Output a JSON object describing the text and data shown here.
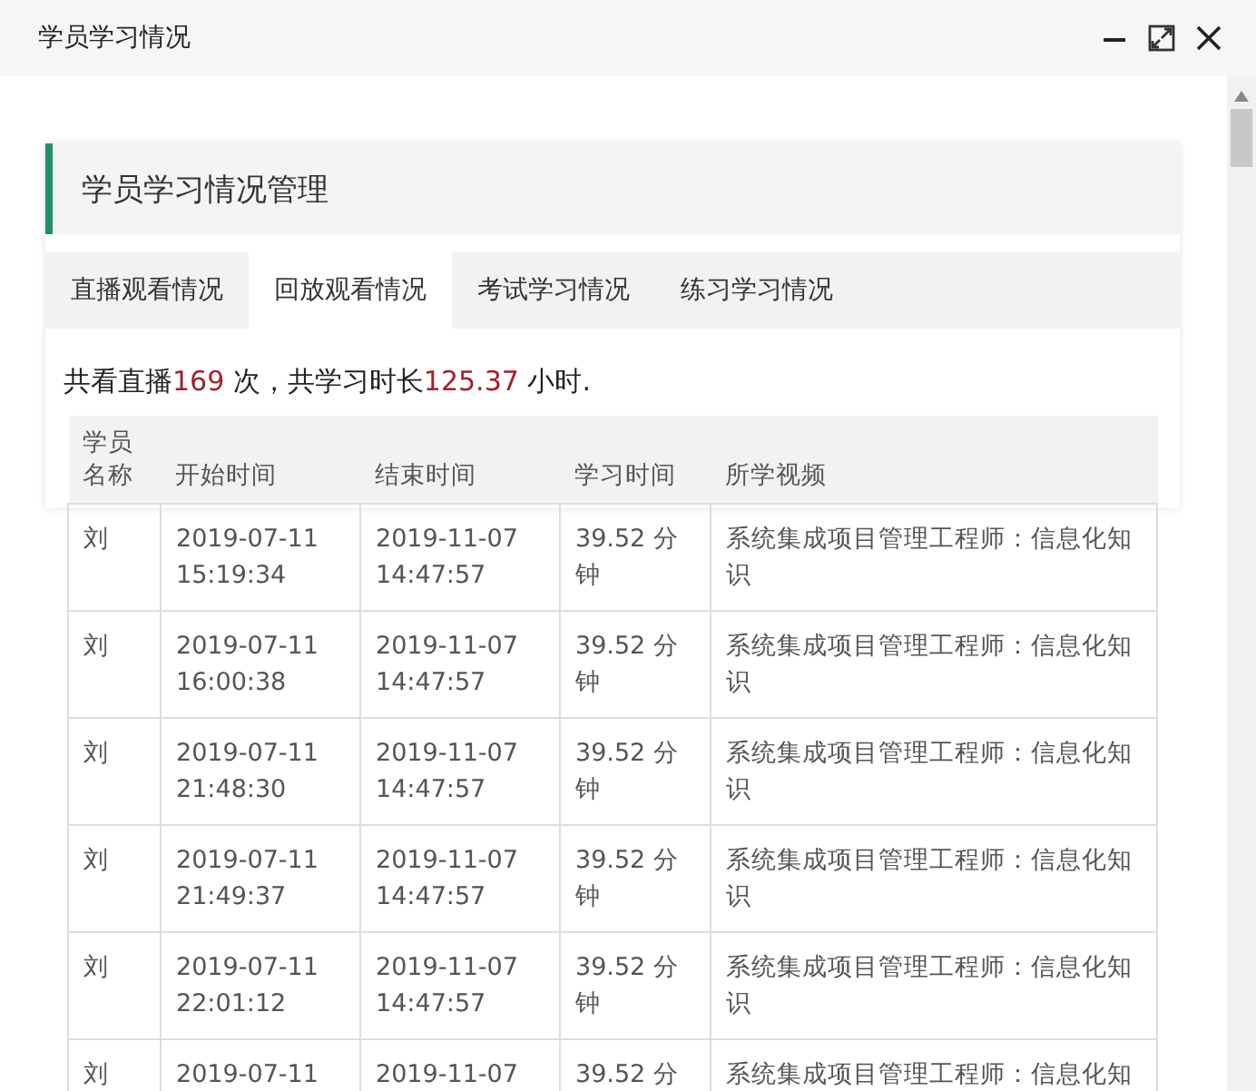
{
  "window": {
    "title": "学员学习情况"
  },
  "panel": {
    "title": "学员学习情况管理"
  },
  "tabs": [
    {
      "label": "直播观看情况",
      "selected": false
    },
    {
      "label": "回放观看情况",
      "selected": true
    },
    {
      "label": "考试学习情况",
      "selected": false
    },
    {
      "label": "练习学习情况",
      "selected": false
    }
  ],
  "summary": [
    {
      "text": "共看直播",
      "highlight": false
    },
    {
      "text": "169",
      "highlight": true
    },
    {
      "text": " 次，共学习时长",
      "highlight": false
    },
    {
      "text": "125.37",
      "highlight": true
    },
    {
      "text": " 小时.",
      "highlight": false
    }
  ],
  "table": {
    "columns": [
      "学员名称",
      "开始时间",
      "结束时间",
      "学习时间",
      "所学视频"
    ],
    "rows": [
      [
        "刘",
        "2019-07-11 15:19:34",
        "2019-11-07 14:47:57",
        "39.52 分钟",
        "系统集成项目管理工程师：信息化知识"
      ],
      [
        "刘",
        "2019-07-11 16:00:38",
        "2019-11-07 14:47:57",
        "39.52 分钟",
        "系统集成项目管理工程师：信息化知识"
      ],
      [
        "刘",
        "2019-07-11 21:48:30",
        "2019-11-07 14:47:57",
        "39.52 分钟",
        "系统集成项目管理工程师：信息化知识"
      ],
      [
        "刘",
        "2019-07-11 21:49:37",
        "2019-11-07 14:47:57",
        "39.52 分钟",
        "系统集成项目管理工程师：信息化知识"
      ],
      [
        "刘",
        "2019-07-11 22:01:12",
        "2019-11-07 14:47:57",
        "39.52 分钟",
        "系统集成项目管理工程师：信息化知识"
      ],
      [
        "刘",
        "2019-07-11",
        "2019-11-07",
        "39.52 分",
        "系统集成项目管理工程师：信息化知"
      ]
    ]
  }
}
